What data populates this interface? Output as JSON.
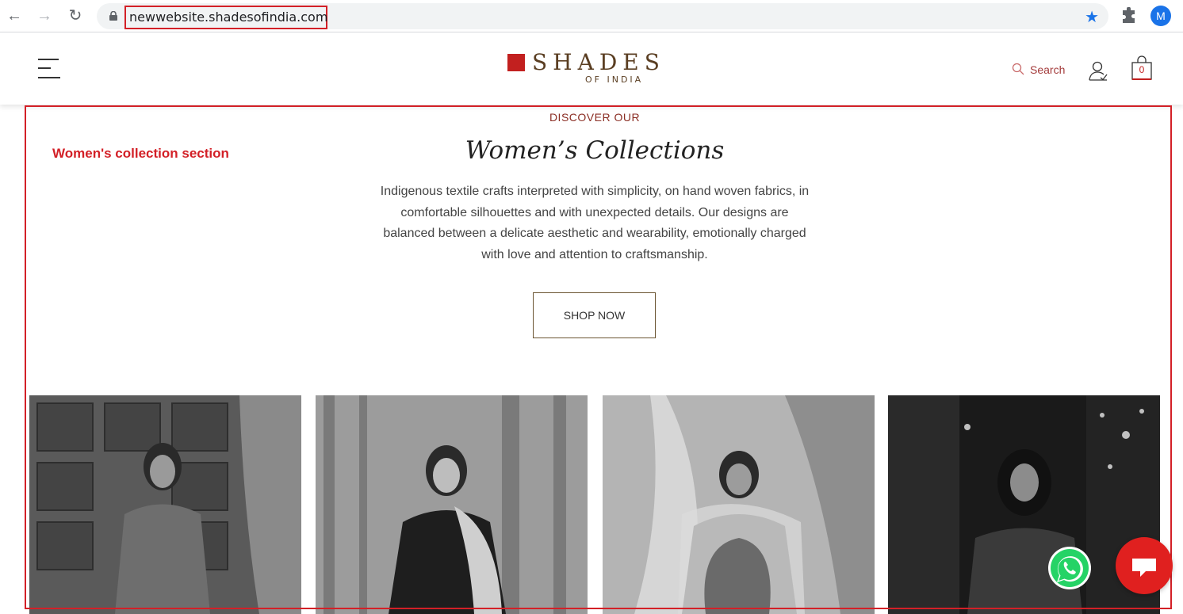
{
  "browser": {
    "url": "newwebsite.shadesofindia.com",
    "profile_initial": "M",
    "accent_color": "#1a73e8"
  },
  "header": {
    "logo_main": "SHADES",
    "logo_sub": "OF INDIA",
    "search_label": "Search",
    "cart_count": "0",
    "brand_color": "#c2201f"
  },
  "annotation": {
    "label": "Women's collection section",
    "color": "#d32027"
  },
  "section": {
    "eyebrow": "DISCOVER OUR",
    "title": "Women’s Collections",
    "description": "Indigenous textile crafts interpreted with simplicity, on hand woven fabrics, in comfortable silhouettes and with unexpected details. Our designs are balanced between a delicate aesthetic and wearability, emotionally charged with love and attention to craftsmanship.",
    "cta_label": "SHOP NOW"
  },
  "products": [
    {
      "image": "woman-in-kurta-by-wooden-door",
      "tone": "mid"
    },
    {
      "image": "woman-in-velvet-suit-before-curtain",
      "tone": "light"
    },
    {
      "image": "woman-with-sheer-drape",
      "tone": "light"
    },
    {
      "image": "woman-in-floral-dress-night-city",
      "tone": "dark"
    }
  ],
  "floating": {
    "whatsapp_icon": "whatsapp-icon",
    "chat_icon": "chat-bubble-icon"
  }
}
